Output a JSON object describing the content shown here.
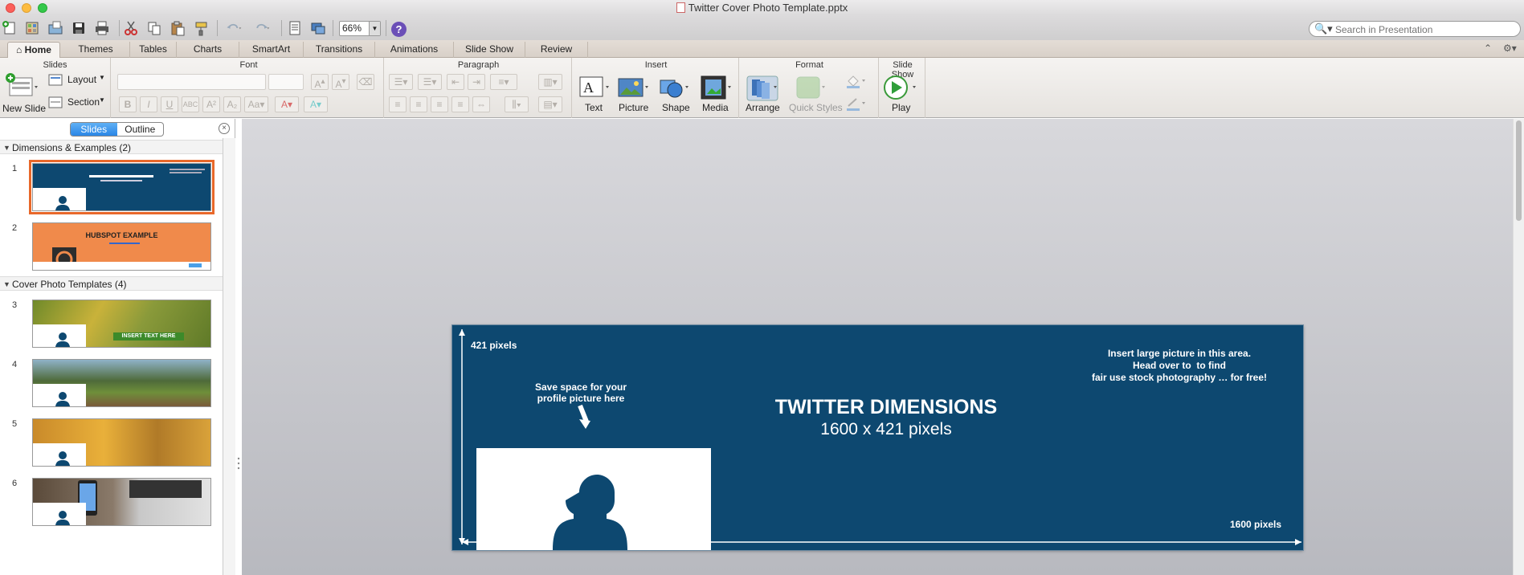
{
  "window": {
    "title": "Twitter Cover Photo Template.pptx"
  },
  "toolbar": {
    "zoom": "66%",
    "help": "?",
    "search_placeholder": "Search in Presentation"
  },
  "tabs": [
    "Home",
    "Themes",
    "Tables",
    "Charts",
    "SmartArt",
    "Transitions",
    "Animations",
    "Slide Show",
    "Review"
  ],
  "ribbon": {
    "groups": {
      "slides": "Slides",
      "font": "Font",
      "paragraph": "Paragraph",
      "insert": "Insert",
      "format": "Format",
      "slideshow": "Slide Show"
    },
    "new_slide": "New Slide",
    "layout": "Layout",
    "section": "Section",
    "text": "Text",
    "picture": "Picture",
    "shape": "Shape",
    "media": "Media",
    "arrange": "Arrange",
    "quick_styles": "Quick Styles",
    "play": "Play"
  },
  "sidebar": {
    "seg_slides": "Slides",
    "seg_outline": "Outline",
    "sections": [
      {
        "label": "Dimensions & Examples (2)"
      },
      {
        "label": "Cover Photo Templates (4)"
      }
    ],
    "slide_numbers": [
      "1",
      "2",
      "3",
      "4",
      "5",
      "6"
    ],
    "thumb2_title": "HUBSPOT EXAMPLE",
    "thumb3_banner": "INSERT TEXT HERE"
  },
  "slide": {
    "height_label": "421 pixels",
    "width_label": "1600 pixels",
    "profile_note_1": "Save space for your",
    "profile_note_2": "profile picture here",
    "title": "TWITTER DIMENSIONS",
    "subtitle": "1600 x 421 pixels",
    "insert_1": "Insert large picture in this area.",
    "insert_2a": "Head over to ",
    "insert_2b": "to find",
    "insert_3": "fair use stock photography … for free!"
  },
  "colors": {
    "slide_bg": "#0d4870",
    "selection": "#e8682a",
    "hubspot": "#f08a4b"
  }
}
